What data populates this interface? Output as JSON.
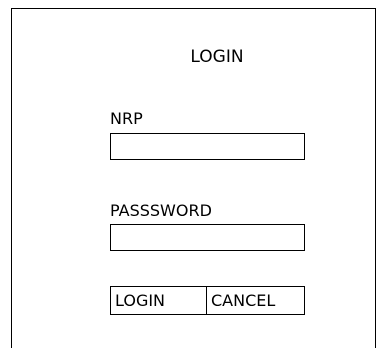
{
  "form": {
    "title": "LOGIN",
    "nrp_label": "NRP",
    "nrp_value": "",
    "password_label": "PASSSWORD",
    "password_value": "",
    "login_button": "LOGIN",
    "cancel_button": "CANCEL"
  }
}
